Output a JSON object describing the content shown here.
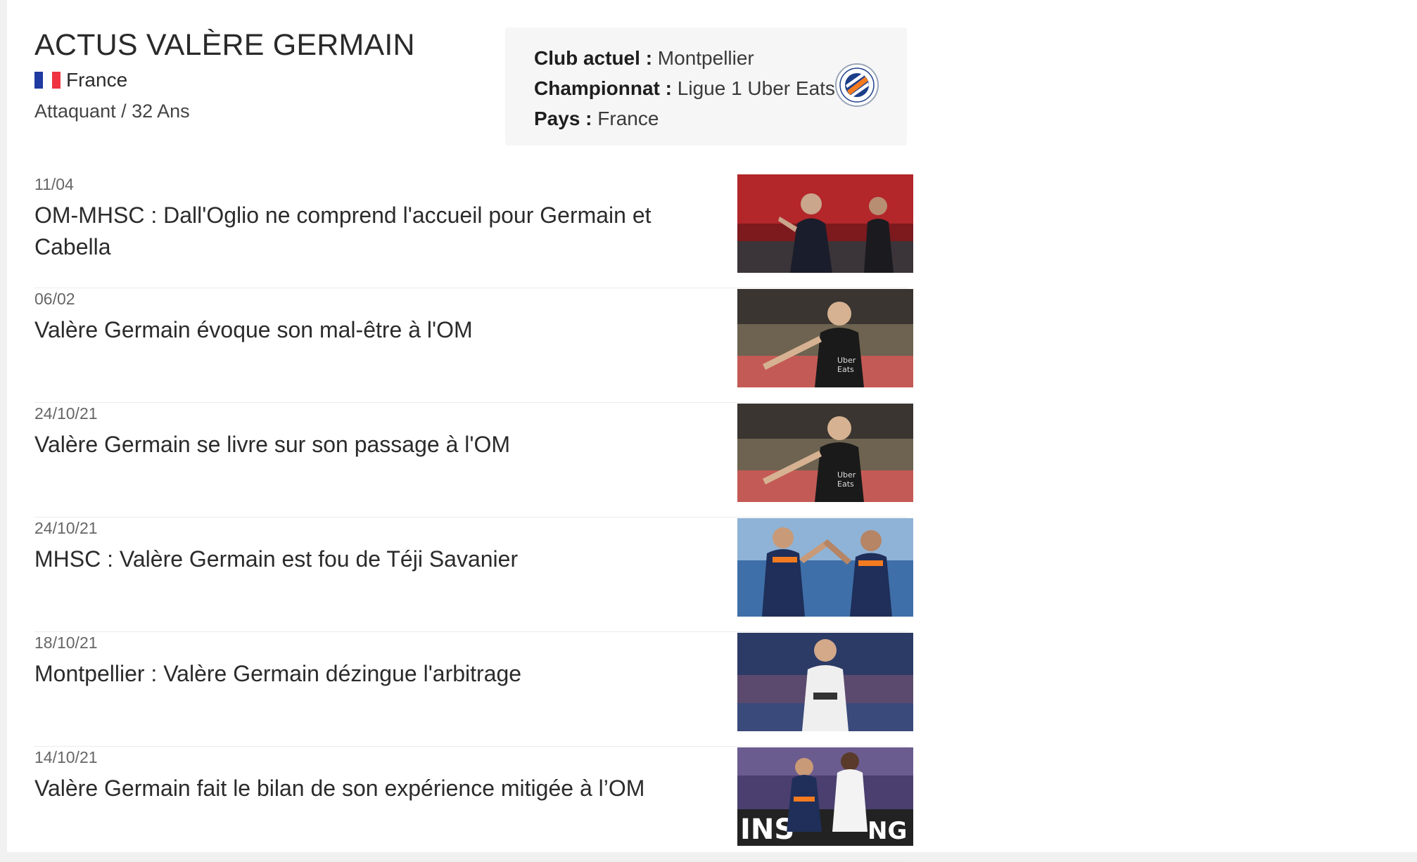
{
  "player": {
    "title": "ACTUS VALÈRE GERMAIN",
    "nationality": "France",
    "position_age": "Attaquant / 32 Ans"
  },
  "flag_colors": [
    "#1f3aa0",
    "#ffffff",
    "#ef3340"
  ],
  "info": {
    "club_label": "Club actuel :",
    "club_value": "Montpellier",
    "league_label": "Championnat :",
    "league_value": "Ligue 1 Uber Eats",
    "country_label": "Pays :",
    "country_value": "France",
    "club_logo_icon": "montpellier-crest-icon"
  },
  "news": [
    {
      "date": "11/04",
      "headline": "OM-MHSC : Dall'Oglio ne comprend l'accueil pour Germain et Cabella",
      "thumb": "coach-gesturing-photo"
    },
    {
      "date": "06/02",
      "headline": "Valère Germain évoque son mal-être à l'OM",
      "thumb": "germain-om-black-kit-photo"
    },
    {
      "date": "24/10/21",
      "headline": "Valère Germain se livre sur son passage à l'OM",
      "thumb": "germain-om-black-kit-photo"
    },
    {
      "date": "24/10/21",
      "headline": "MHSC : Valère Germain est fou de Téji Savanier",
      "thumb": "players-high-five-photo"
    },
    {
      "date": "18/10/21",
      "headline": "Montpellier : Valère Germain dézingue l'arbitrage",
      "thumb": "germain-white-kit-photo"
    },
    {
      "date": "14/10/21",
      "headline": "Valère Germain fait le bilan de son expérience mitigée à l’OM",
      "thumb": "match-action-photo"
    }
  ]
}
